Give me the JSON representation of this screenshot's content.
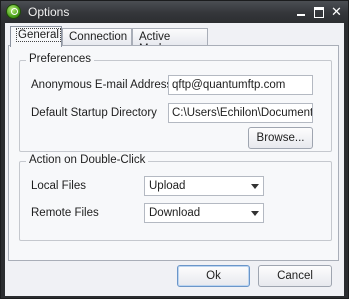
{
  "window": {
    "title": "Options"
  },
  "tabs": [
    {
      "label": "General",
      "active": true
    },
    {
      "label": "Connection",
      "active": false
    },
    {
      "label": "Active Mode",
      "active": false
    }
  ],
  "preferences": {
    "title": "Preferences",
    "email_label": "Anonymous E-mail Address",
    "email_value": "qftp@quantumftp.com",
    "startup_label": "Default Startup Directory",
    "startup_value": "C:\\Users\\Echilon\\Documents",
    "browse_label": "Browse..."
  },
  "double_click": {
    "title": "Action on Double-Click",
    "local_label": "Local Files",
    "local_value": "Upload",
    "remote_label": "Remote Files",
    "remote_value": "Download"
  },
  "footer": {
    "ok_label": "Ok",
    "cancel_label": "Cancel"
  },
  "icons": {
    "app": "quantumftp-app-icon",
    "minimize": "minimize-icon",
    "maximize": "maximize-icon",
    "close": "close-icon"
  },
  "colors": {
    "titlebar": "#34363a",
    "client": "#f0f1f5",
    "default_button_border": "#6b96c9"
  }
}
